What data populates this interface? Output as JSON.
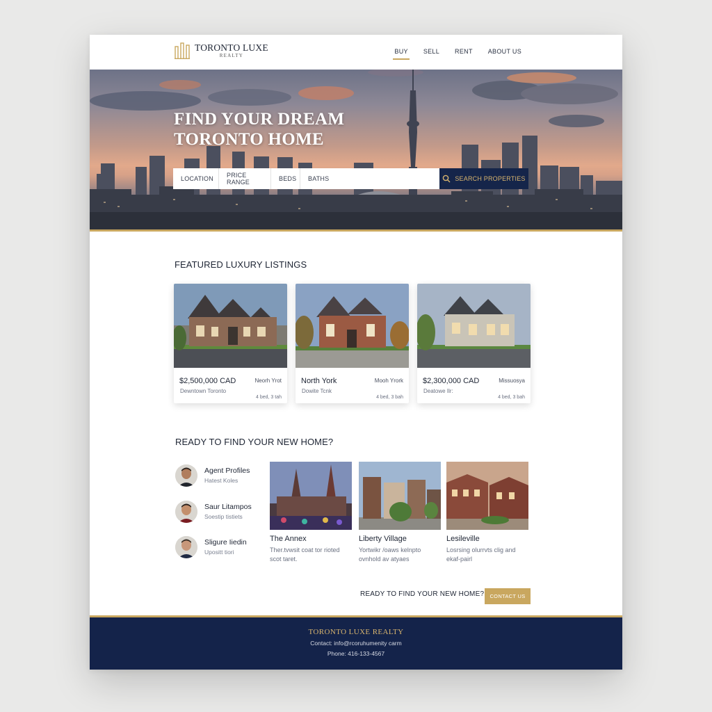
{
  "brand": {
    "name": "TORONTO LUXE",
    "sub": "REALTY",
    "accent": "#c9a75f",
    "navy": "#14234a"
  },
  "nav": {
    "items": [
      "BUY",
      "SELL",
      "RENT",
      "ABOUT US"
    ],
    "active": "BUY"
  },
  "hero": {
    "title_line1": "FIND YOUR DREAM",
    "title_line2": "TORONTO HOME",
    "search": {
      "location": "LOCATION",
      "price": "PRICE RANGE",
      "beds": "BEDS",
      "baths": "BATHS",
      "button": "SEARCH PROPERTIES",
      "button_icon": "search-icon"
    }
  },
  "featured": {
    "title": "FEATURED LUXURY LISTINGS",
    "cards": [
      {
        "price": "$2,500,000 CAD",
        "location": "Neorh Yrot",
        "area": "Dewntown Toronto",
        "beds": "4 bed, 3 tah"
      },
      {
        "price": "North York",
        "location": "Mooh Yrork",
        "area": "Dowite Tcnk",
        "beds": "4 bed, 3 bah"
      },
      {
        "price": "$2,300,000 CAD",
        "location": "Missuosya",
        "area": "Deatowe Ilr:",
        "beds": "4 bed, 3 bah"
      }
    ]
  },
  "ready": {
    "title": "READY TO FIND YOUR NEW HOME?",
    "agents": [
      {
        "name": "Agent Profiles",
        "sub": "Hatest Koles"
      },
      {
        "name": "Saur Litampos",
        "sub": "Soestip tistiets"
      },
      {
        "name": "Sligure Iiedin",
        "sub": "Upositt tiori"
      }
    ],
    "neighborhoods": [
      {
        "name": "The Annex",
        "desc_line1": "Ther.tvwsit coat tor rioted",
        "desc_line2": "scot taret."
      },
      {
        "name": "Liberty Village",
        "desc_line1": "Yortwikr /oaws kelnpto",
        "desc_line2": "ovnhold av atyaes"
      },
      {
        "name": "Lesileville",
        "desc_line1": "Losrsing olurrvts clig and",
        "desc_line2": "ekaf-pairl"
      }
    ],
    "cta_text": "READY TO FIND YOUR NEW HOME?",
    "cta_button": "CONTACT US"
  },
  "footer": {
    "brand": "TORONTO LUXE REALTY",
    "contact": "Contact: info@rcoruhumenity carm",
    "phone": "Phone: 416-133-4567"
  }
}
